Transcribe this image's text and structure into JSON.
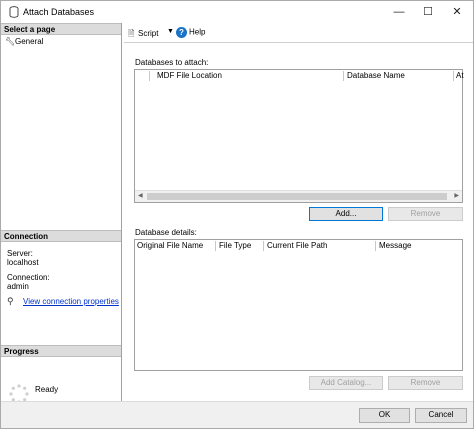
{
  "window": {
    "title": "Attach Databases",
    "minimize": "—",
    "maximize": "☐",
    "close": "✕"
  },
  "left": {
    "select_page_header": "Select a page",
    "pages": [
      {
        "label": "General",
        "icon": "wrench-icon"
      }
    ],
    "connection_header": "Connection",
    "server_label": "Server:",
    "server_value": "localhost",
    "connection_label": "Connection:",
    "connection_value": "admin",
    "view_connection_link": "View connection properties",
    "progress_header": "Progress",
    "progress_status": "Ready"
  },
  "toolbar": {
    "script_label": "Script",
    "help_label": "Help"
  },
  "attach": {
    "label": "Databases to attach:",
    "columns": [
      "MDF File Location",
      "Database Name",
      "At"
    ],
    "add_button": "Add...",
    "remove_button": "Remove"
  },
  "details": {
    "label": "Database details:",
    "columns": [
      "Original File Name",
      "File Type",
      "Current File Path",
      "Message"
    ],
    "add_catalog_button": "Add Catalog...",
    "remove_button": "Remove"
  },
  "footer": {
    "ok_button": "OK",
    "cancel_button": "Cancel"
  }
}
